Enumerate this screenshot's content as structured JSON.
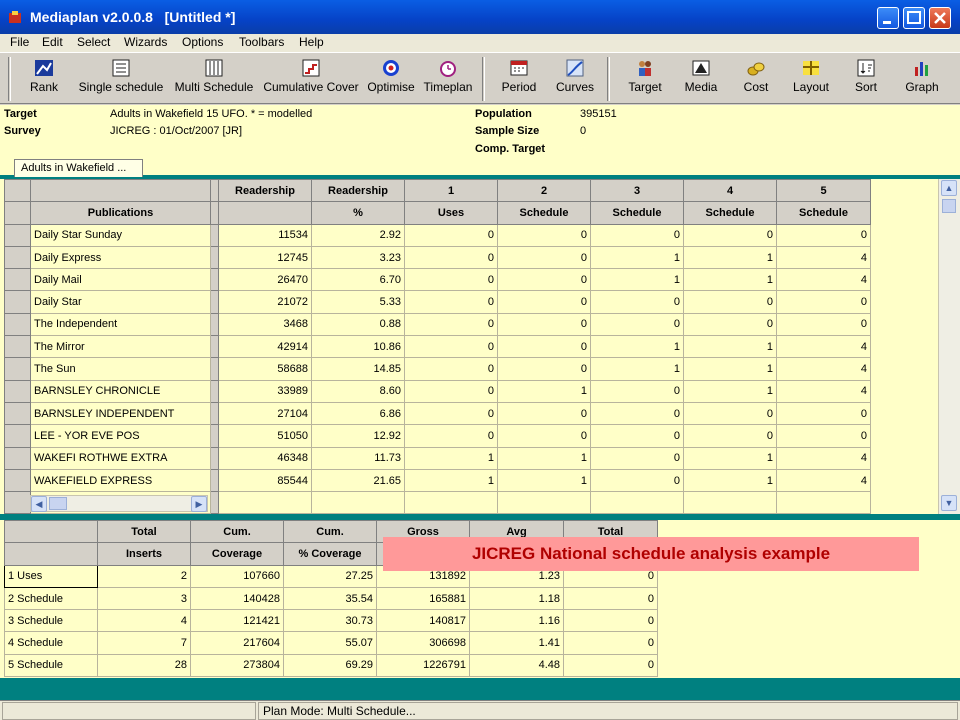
{
  "window": {
    "title": "Mediaplan v2.0.0.8   [Untitled *]"
  },
  "menu": [
    "File",
    "Edit",
    "Select",
    "Wizards",
    "Options",
    "Toolbars",
    "Help"
  ],
  "toolbar": {
    "buttons": [
      "Rank",
      "Single schedule",
      "Multi Schedule",
      "Cumulative Cover",
      "Optimise",
      "Timeplan",
      "Period",
      "Curves",
      "Target",
      "Media",
      "Cost",
      "Layout",
      "Sort",
      "Graph"
    ]
  },
  "info": {
    "target_label": "Target",
    "target_value": "Adults in Wakefield 15 UFO.  * = modelled",
    "survey_label": "Survey",
    "survey_value": "JICREG : 01/Oct/2007 [JR]",
    "population_label": "Population",
    "population_value": "395151",
    "sample_label": "Sample Size",
    "sample_value": "0",
    "comp_label": "Comp. Target"
  },
  "tab": {
    "label": "Adults in Wakefield ..."
  },
  "publications": {
    "header_top": [
      "Readership",
      "Readership",
      "1",
      "2",
      "3",
      "4",
      "5"
    ],
    "header_bottom": [
      "Publications",
      "",
      "%",
      "Uses",
      "Schedule",
      "Schedule",
      "Schedule",
      "Schedule"
    ],
    "rows": [
      [
        "Daily Star Sunday",
        "11534",
        "2.92",
        "0",
        "0",
        "0",
        "0",
        "0"
      ],
      [
        "Daily Express",
        "12745",
        "3.23",
        "0",
        "0",
        "1",
        "1",
        "4"
      ],
      [
        "Daily Mail",
        "26470",
        "6.70",
        "0",
        "0",
        "1",
        "1",
        "4"
      ],
      [
        "Daily Star",
        "21072",
        "5.33",
        "0",
        "0",
        "0",
        "0",
        "0"
      ],
      [
        "The Independent",
        "3468",
        "0.88",
        "0",
        "0",
        "0",
        "0",
        "0"
      ],
      [
        "The Mirror",
        "42914",
        "10.86",
        "0",
        "0",
        "1",
        "1",
        "4"
      ],
      [
        "The Sun",
        "58688",
        "14.85",
        "0",
        "0",
        "1",
        "1",
        "4"
      ],
      [
        "BARNSLEY CHRONICLE",
        "33989",
        "8.60",
        "0",
        "1",
        "0",
        "1",
        "4"
      ],
      [
        "BARNSLEY INDEPENDENT",
        "27104",
        "6.86",
        "0",
        "0",
        "0",
        "0",
        "0"
      ],
      [
        "LEE - YOR EVE POS",
        "51050",
        "12.92",
        "0",
        "0",
        "0",
        "0",
        "0"
      ],
      [
        "WAKEFI ROTHWE EXTRA",
        "46348",
        "11.73",
        "1",
        "1",
        "0",
        "1",
        "4"
      ],
      [
        "WAKEFIELD EXPRESS",
        "85544",
        "21.65",
        "1",
        "1",
        "0",
        "1",
        "4"
      ]
    ]
  },
  "summary": {
    "header_top": [
      "Total",
      "Cum.",
      "Cum.",
      "Gross",
      "Avg",
      "Total"
    ],
    "header_bottom": [
      "Inserts",
      "Coverage",
      "% Coverage",
      "",
      "",
      ""
    ],
    "rows": [
      [
        "1 Uses",
        "2",
        "107660",
        "27.25",
        "131892",
        "1.23",
        "0"
      ],
      [
        "2 Schedule",
        "3",
        "140428",
        "35.54",
        "165881",
        "1.18",
        "0"
      ],
      [
        "3 Schedule",
        "4",
        "121421",
        "30.73",
        "140817",
        "1.16",
        "0"
      ],
      [
        "4 Schedule",
        "7",
        "217604",
        "55.07",
        "306698",
        "1.41",
        "0"
      ],
      [
        "5 Schedule",
        "28",
        "273804",
        "69.29",
        "1226791",
        "4.48",
        "0"
      ]
    ]
  },
  "caption": "JICREG National schedule analysis example",
  "status": {
    "mode": "Plan Mode: Multi Schedule..."
  },
  "colors": {
    "accent": "#008080",
    "grid_bg": "#ffffc8",
    "caption_bg": "#ff9999",
    "caption_text": "#b00000"
  }
}
